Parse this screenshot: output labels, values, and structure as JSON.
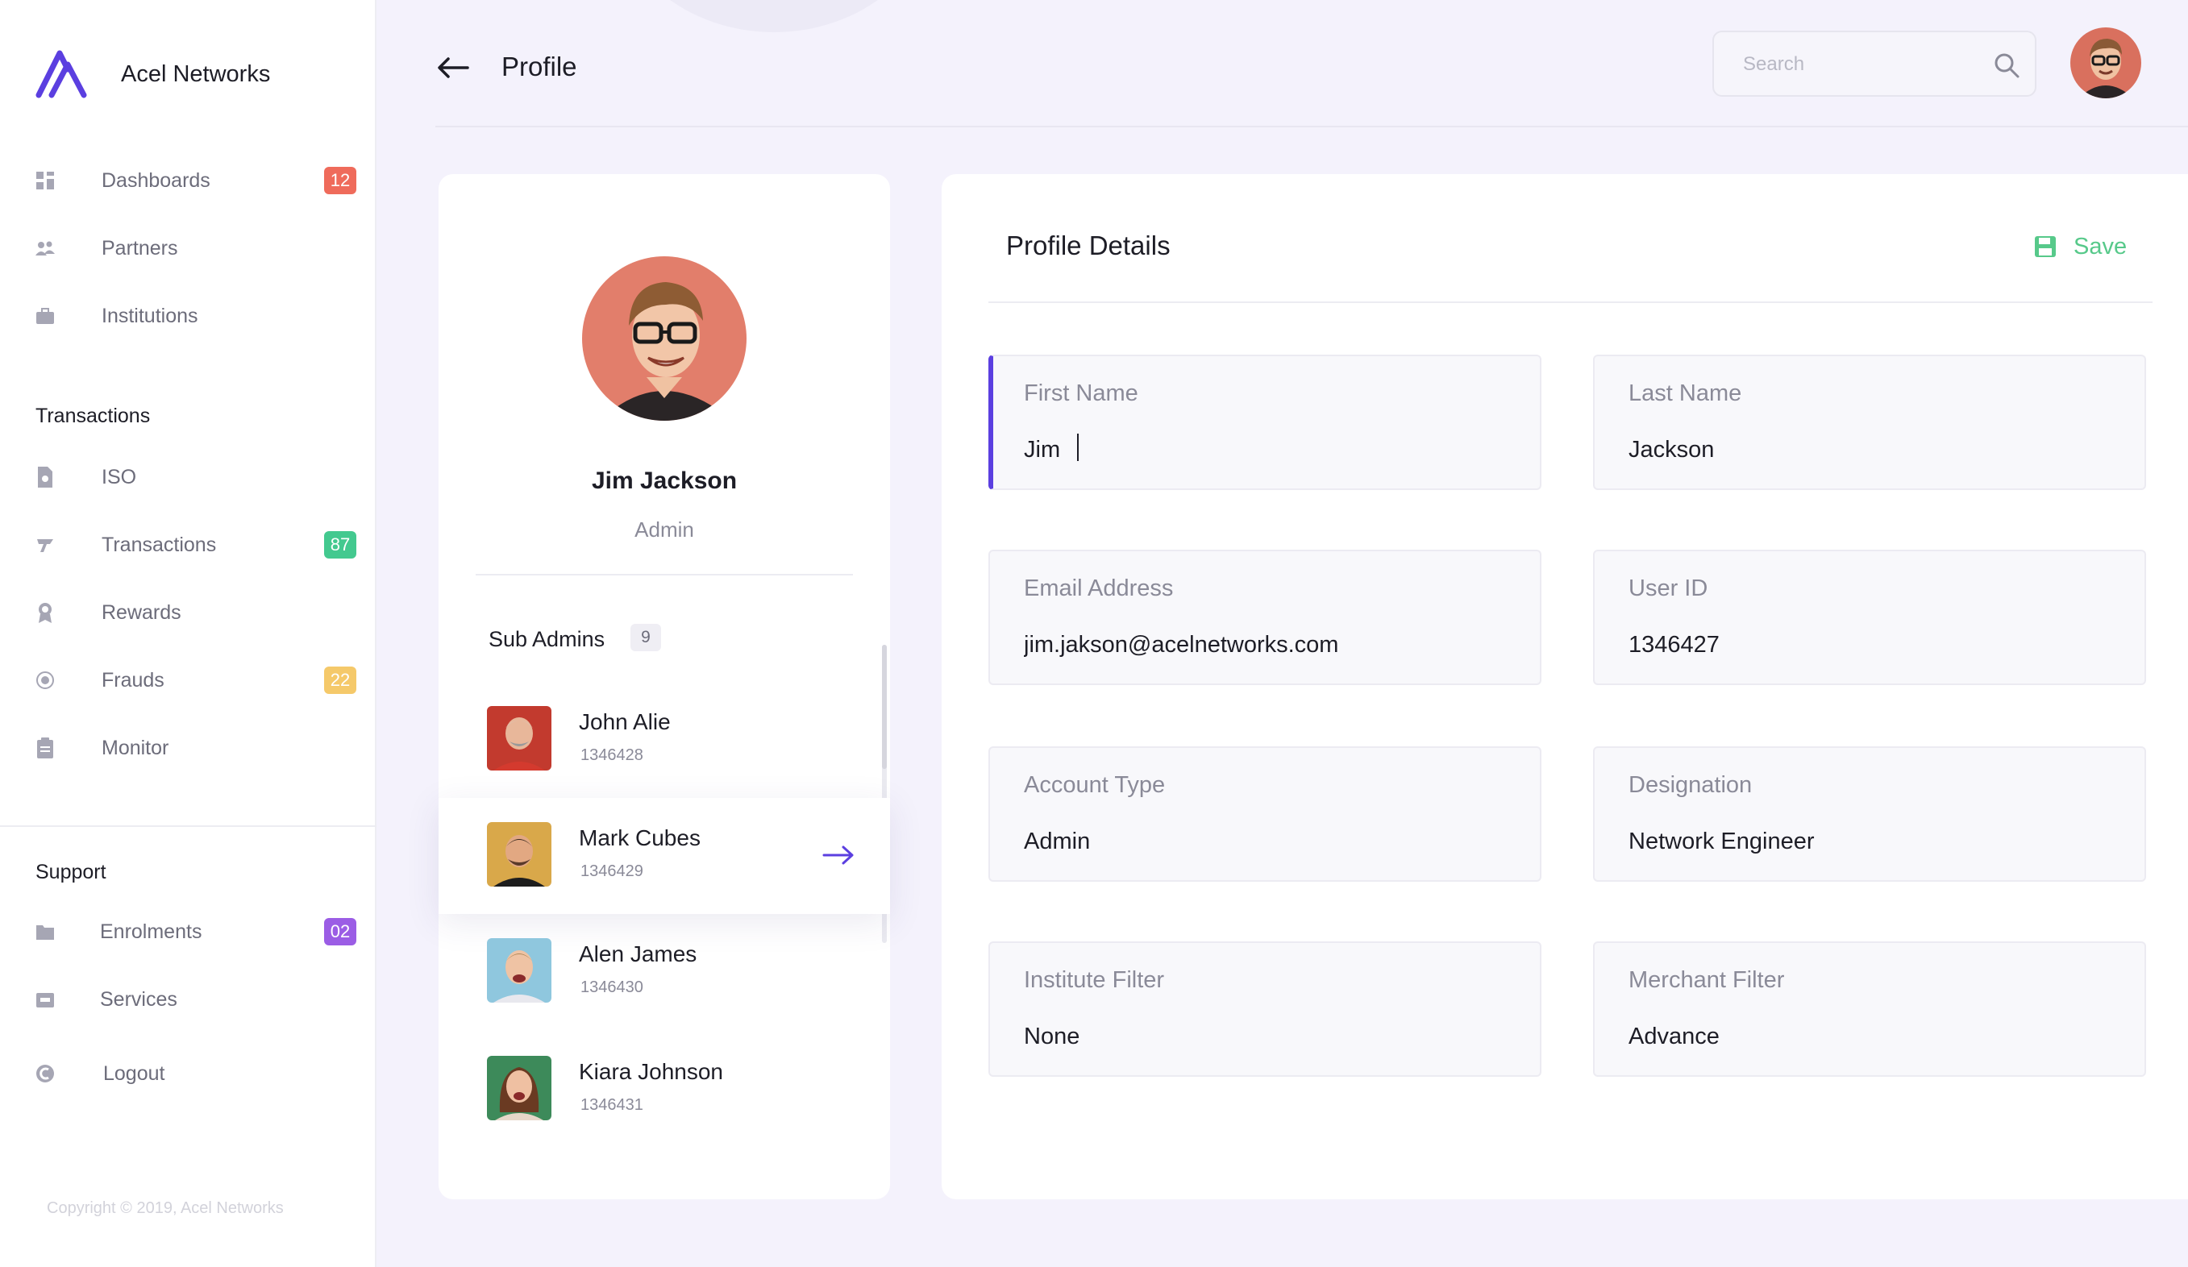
{
  "brand": {
    "name": "Acel Networks",
    "accent": "#5b3fe0"
  },
  "sidebar": {
    "items": [
      {
        "label": "Dashboards",
        "icon": "grid-icon",
        "badge": "12",
        "badge_color": "#ef6b5b"
      },
      {
        "label": "Partners",
        "icon": "people-icon",
        "badge": null
      },
      {
        "label": "Institutions",
        "icon": "briefcase-icon",
        "badge": null
      }
    ],
    "transactions_section": {
      "title": "Transactions",
      "items": [
        {
          "label": "ISO",
          "icon": "document-icon",
          "badge": null
        },
        {
          "label": "Transactions",
          "icon": "tag-icon",
          "badge": "87",
          "badge_color": "#43c98f"
        },
        {
          "label": "Rewards",
          "icon": "award-icon",
          "badge": null
        },
        {
          "label": "Frauds",
          "icon": "alert-icon",
          "badge": "22",
          "badge_color": "#f5c96a"
        },
        {
          "label": "Monitor",
          "icon": "clipboard-icon",
          "badge": null
        }
      ]
    },
    "support_section": {
      "title": "Support",
      "items": [
        {
          "label": "Enrolments",
          "icon": "folder-icon",
          "badge": "02",
          "badge_color": "#9b5de5"
        },
        {
          "label": "Services",
          "icon": "box-icon",
          "badge": null
        },
        {
          "label": "Logout",
          "icon": "logout-icon",
          "badge": null
        }
      ]
    },
    "copyright": "Copyright © 2019, Acel Networks"
  },
  "header": {
    "title": "Profile",
    "search_placeholder": "Search"
  },
  "profile": {
    "name": "Jim Jackson",
    "role": "Admin",
    "sub_admins_title": "Sub Admins",
    "sub_admins_count": "9",
    "sub_admins": [
      {
        "name": "John Alie",
        "id": "1346428",
        "active": false
      },
      {
        "name": "Mark Cubes",
        "id": "1346429",
        "active": true
      },
      {
        "name": "Alen James",
        "id": "1346430",
        "active": false
      },
      {
        "name": "Kiara Johnson",
        "id": "1346431",
        "active": false
      }
    ]
  },
  "details": {
    "title": "Profile Details",
    "save_label": "Save",
    "save_color": "#57c98a",
    "fields": [
      {
        "label": "First Name",
        "value": "Jim",
        "focused": true
      },
      {
        "label": "Last Name",
        "value": "Jackson",
        "focused": false
      },
      {
        "label": "Email Address",
        "value": "jim.jakson@acelnetworks.com",
        "focused": false
      },
      {
        "label": "User ID",
        "value": "1346427",
        "focused": false
      },
      {
        "label": "Account Type",
        "value": "Admin",
        "focused": false
      },
      {
        "label": "Designation",
        "value": "Network Engineer",
        "focused": false
      },
      {
        "label": "Institute Filter",
        "value": "None",
        "focused": false
      },
      {
        "label": "Merchant Filter",
        "value": "Advance",
        "focused": false
      }
    ]
  }
}
